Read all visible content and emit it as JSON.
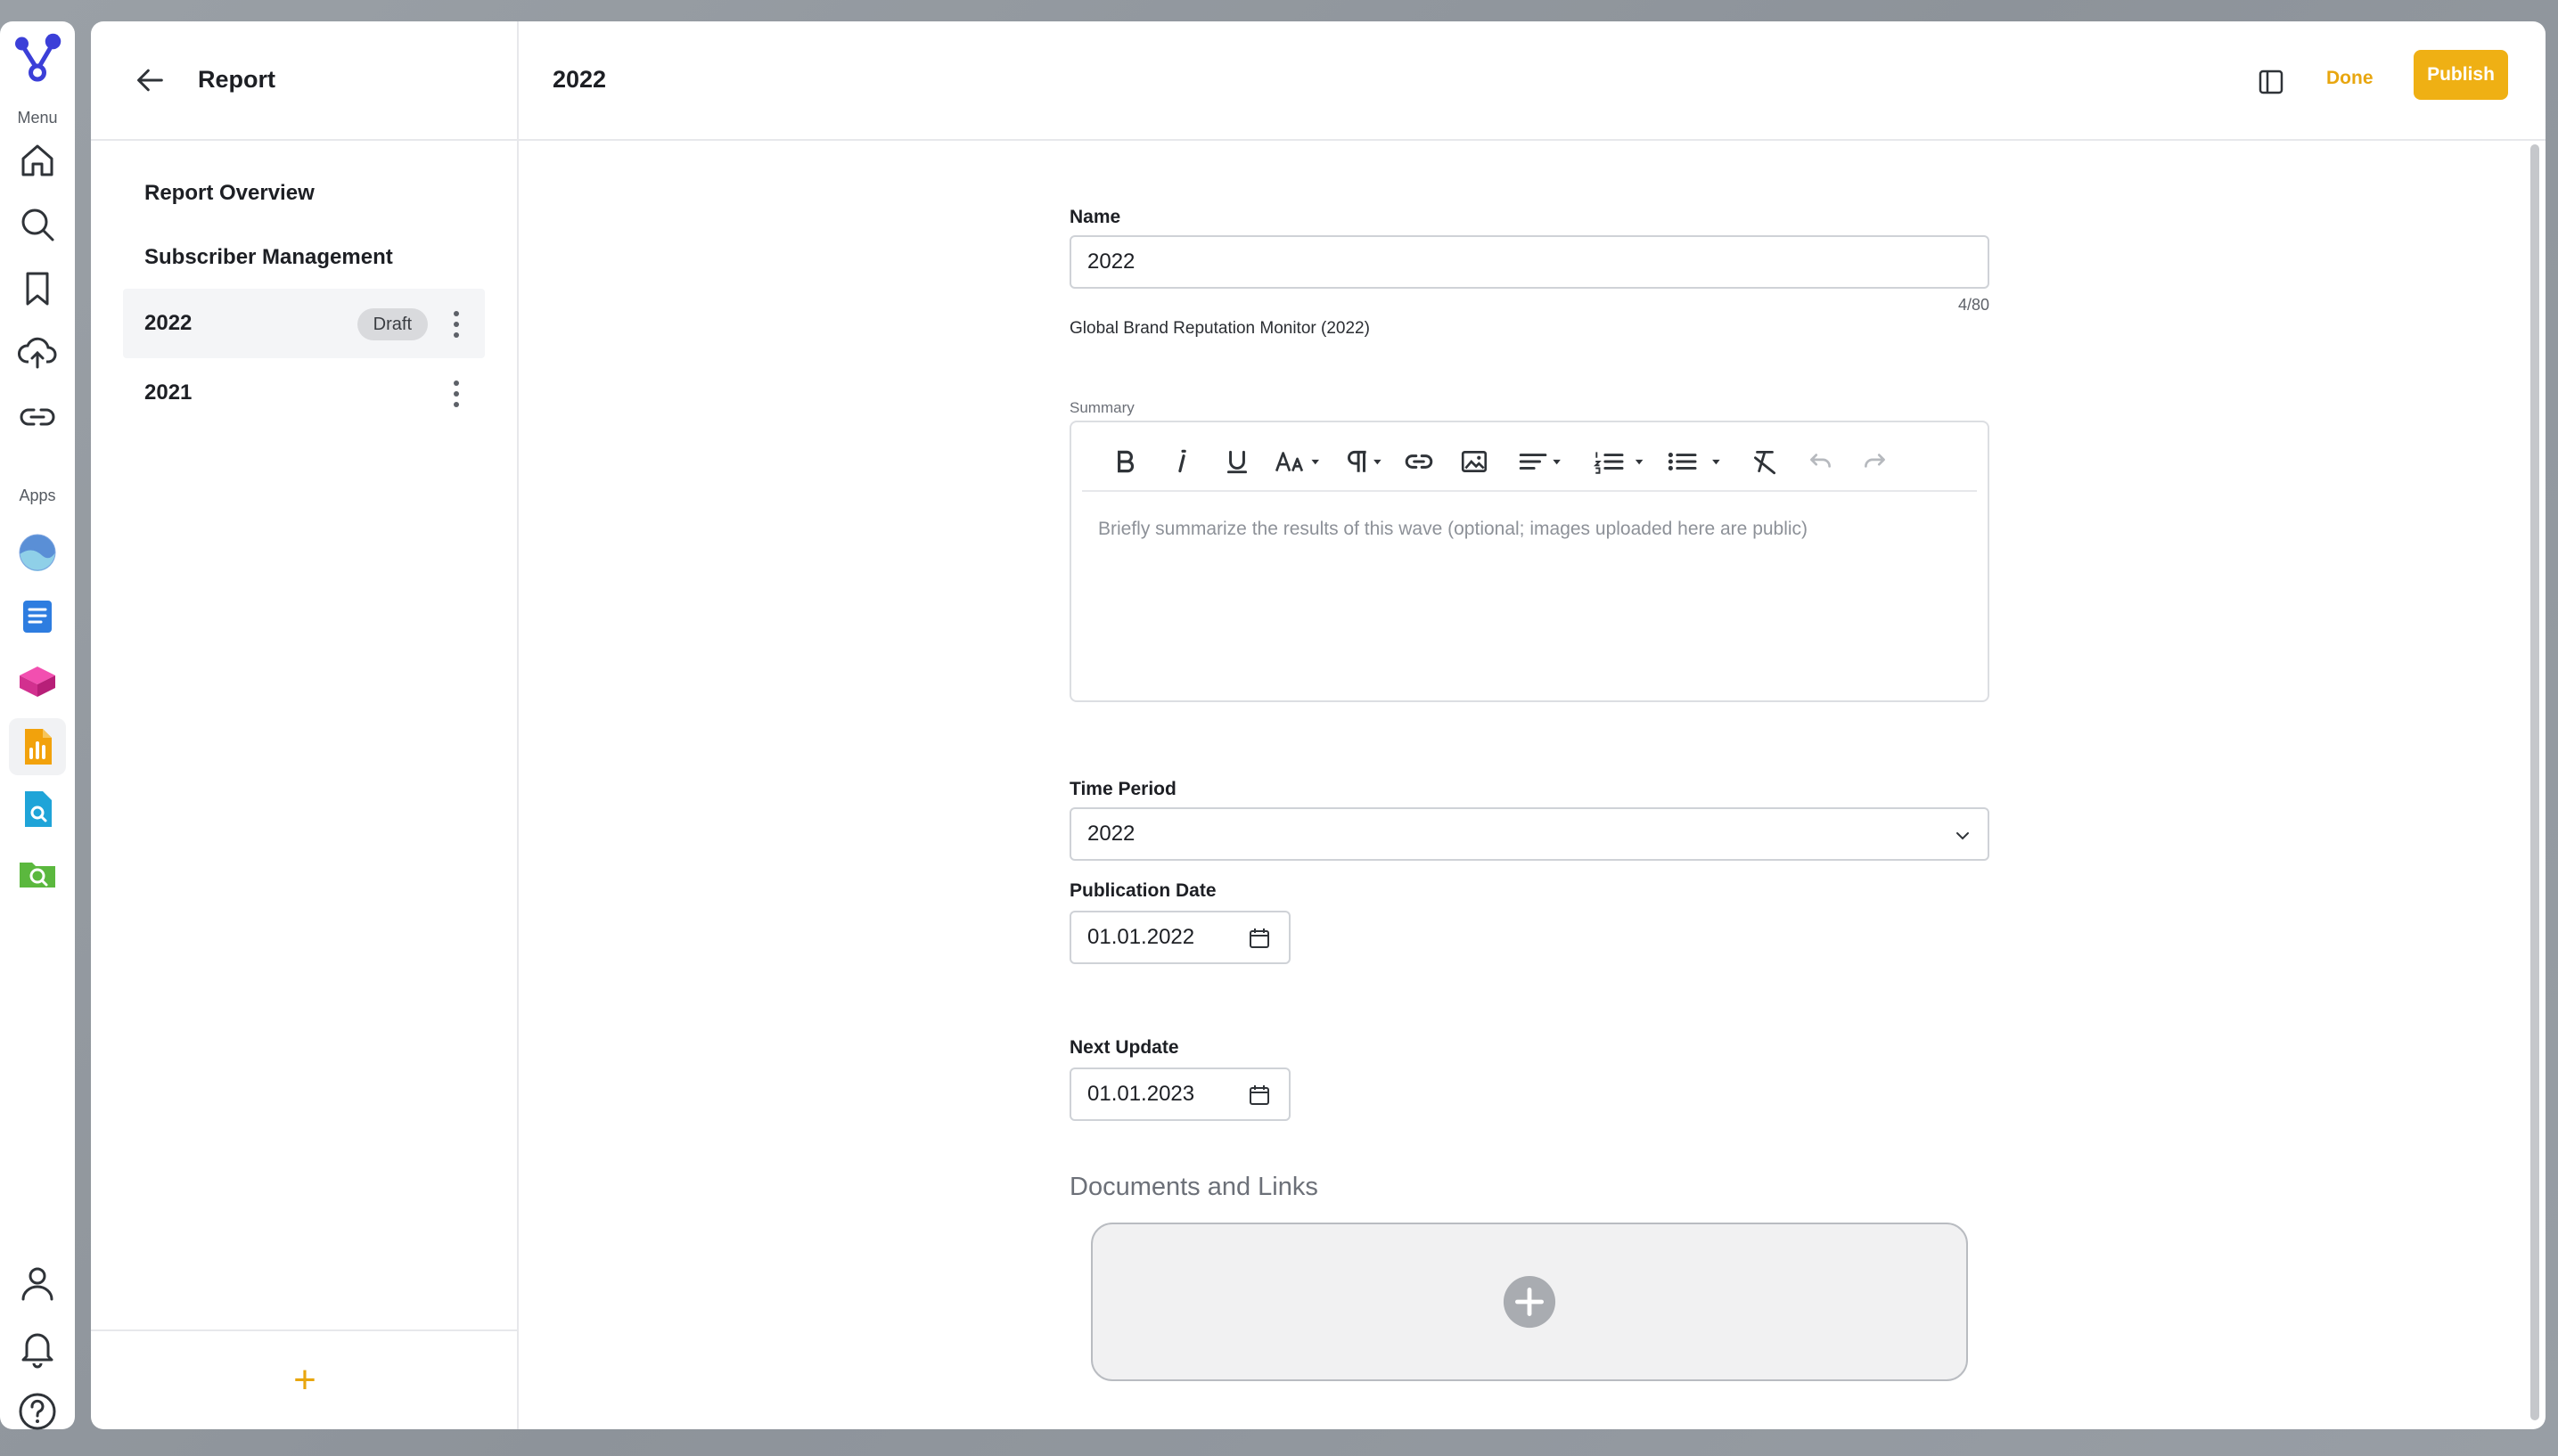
{
  "rail": {
    "menu_label": "Menu",
    "apps_label": "Apps",
    "menu_items": [
      "home-icon",
      "search-icon",
      "bookmark-icon",
      "upload-cloud-icon",
      "link-icon"
    ],
    "apps": [
      "brand-app-icon",
      "document-list-app-icon",
      "cube-app-icon",
      "report-app-icon",
      "file-search-app-icon",
      "folder-search-app-icon"
    ],
    "bottom_items": [
      "user-icon",
      "bell-icon",
      "help-icon"
    ]
  },
  "sidebar": {
    "title": "Report",
    "items": [
      {
        "label": "Report Overview"
      },
      {
        "label": "Subscriber Management"
      },
      {
        "label": "2022",
        "badge": "Draft",
        "selected": true
      },
      {
        "label": "2021"
      }
    ],
    "add_label": "+"
  },
  "header": {
    "title": "2022",
    "done_label": "Done",
    "publish_label": "Publish"
  },
  "form": {
    "name_label": "Name",
    "name_value": "2022",
    "name_counter": "4/80",
    "name_helper": "Global Brand Reputation Monitor (2022)",
    "summary_label": "Summary",
    "summary_placeholder": "Briefly summarize the results of this wave (optional; images uploaded here are public)",
    "time_period_label": "Time Period",
    "time_period_value": "2022",
    "publication_date_label": "Publication Date",
    "publication_date_value": "01.01.2022",
    "next_update_label": "Next Update",
    "next_update_value": "01.01.2023",
    "documents_title": "Documents and Links"
  },
  "colors": {
    "accent": "#efb014",
    "accent_text": "#e8a60f",
    "brand": "#3b3fd8"
  }
}
